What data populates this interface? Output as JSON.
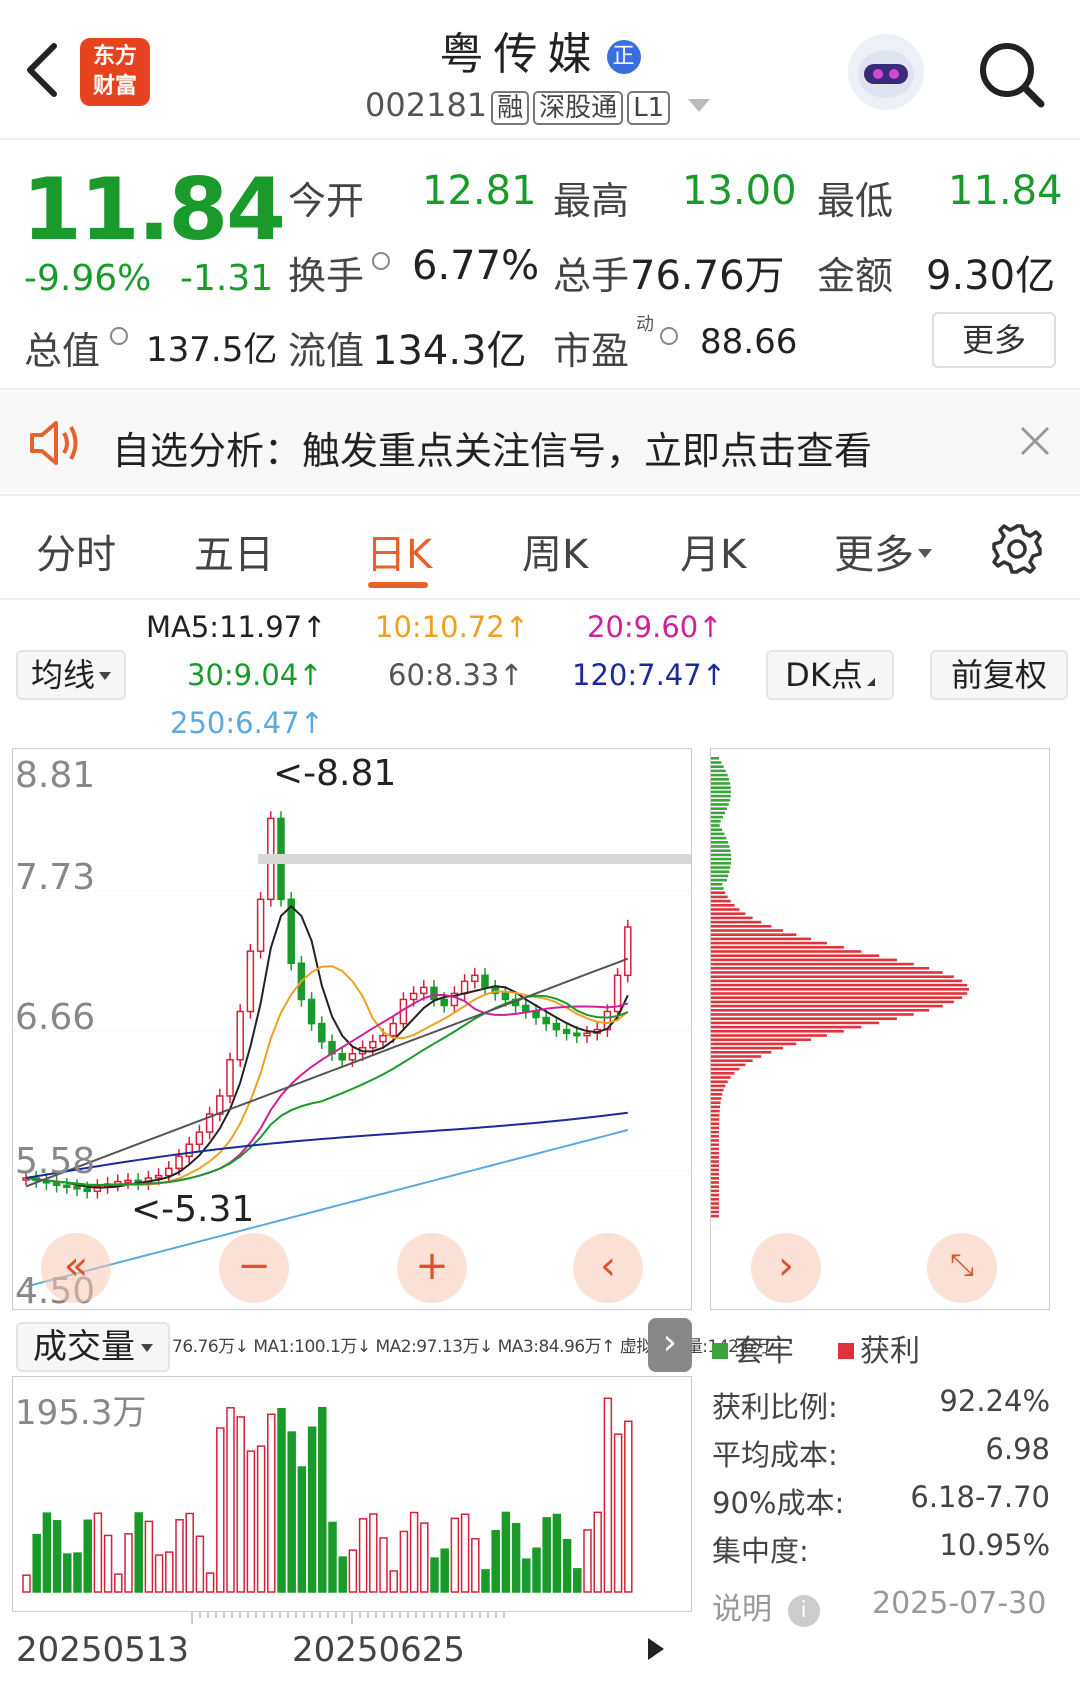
{
  "header": {
    "title": "粤传媒",
    "title_badge": "正",
    "code": "002181",
    "tags": [
      "融",
      "深股通",
      "L1"
    ],
    "logo_line1": "东方",
    "logo_line2": "财富"
  },
  "quote": {
    "price": "11.84",
    "change_pct": "-9.96%",
    "change_amt": "-1.31",
    "open_label": "今开",
    "open": "12.81",
    "high_label": "最高",
    "high": "13.00",
    "low_label": "最低",
    "low": "11.84",
    "turnover_label": "换手",
    "turnover": "6.77%",
    "volume_label": "总手",
    "volume": "76.76万",
    "amount_label": "金额",
    "amount": "9.30亿",
    "mktcap_label": "总值",
    "mktcap": "137.5亿",
    "float_label": "流值",
    "float_cap": "134.3亿",
    "pe_label": "市盈",
    "pe_sup": "动",
    "pe": "88.66",
    "more_label": "更多"
  },
  "notice": {
    "text": "自选分析：触发重点关注信号，立即点击查看"
  },
  "tabs": [
    "分时",
    "五日",
    "日K",
    "周K",
    "月K",
    "更多"
  ],
  "active_tab": "日K",
  "ma": {
    "select_label": "均线",
    "ma5": "MA5:11.97↑",
    "ma10": "10:10.72↑",
    "ma20": "20:9.60↑",
    "ma30": "30:9.04↑",
    "ma60": "60:8.33↑",
    "ma120": "120:7.47↑",
    "ma250": "250:6.47↑",
    "dk_label": "DK点",
    "adjust_label": "前复权",
    "colors": {
      "ma5": "#222222",
      "ma10": "#f0a020",
      "ma20": "#d0209a",
      "ma30": "#1a9a2a",
      "ma60": "#555555",
      "ma120": "#1a2a9a",
      "ma250": "#5aaae0"
    }
  },
  "kchart": {
    "y_labels": [
      "8.81",
      "7.73",
      "6.66",
      "5.58",
      "4.50"
    ],
    "high_note": "<-8.81",
    "low_note": "<-5.31"
  },
  "volume": {
    "select_label": "成交量",
    "stats": "76.76万↓ MA1:100.1万↓ MA2:97.13万↓ MA3:84.96万↑ 虚拟成交量:142.6万",
    "max_label": "195.3万",
    "date_start": "20250513",
    "date_mid": "20250625"
  },
  "chips": {
    "legend_trapped": "套牢",
    "legend_profit": "获利",
    "profit_ratio_label": "获利比例:",
    "profit_ratio": "92.24%",
    "avg_cost_label": "平均成本:",
    "avg_cost": "6.98",
    "cost90_label": "90%成本:",
    "cost90": "6.18-7.70",
    "concentration_label": "集中度:",
    "concentration": "10.95%",
    "note_label": "说明",
    "date": "2025-07-30"
  }
}
